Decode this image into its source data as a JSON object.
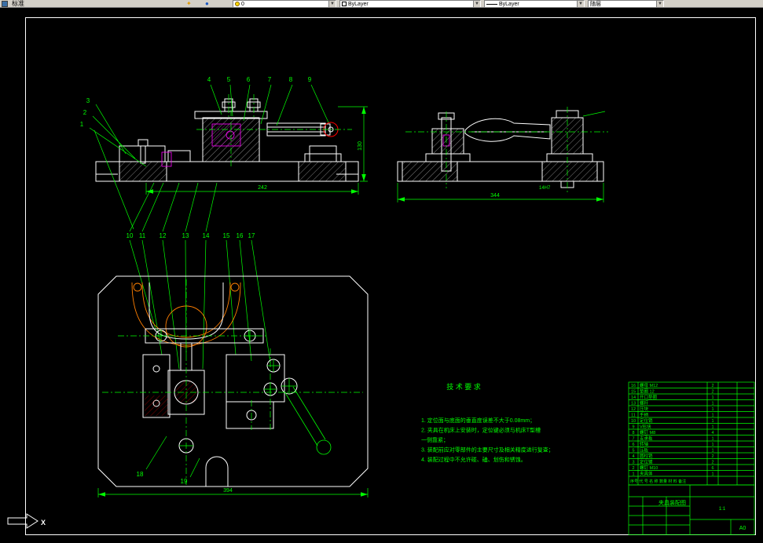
{
  "toolbar": {
    "name": "标准",
    "layer_value": "0",
    "color_value": "ByLayer",
    "linetype_value": "ByLayer",
    "lineweight_value": "随层"
  },
  "colors": {
    "canvas_bg": "#000000",
    "toolbar_bg": "#d4d0c8",
    "geometry": "#ffffff",
    "annotation": "#00ff00",
    "detail_magenta": "#ff00ff",
    "detail_red": "#ff0000",
    "workpiece_orange": "#ff7f00"
  },
  "drawing": {
    "dimensions": {
      "front_width": "242",
      "front_height": "130",
      "side_width": "344",
      "side_key_slot": "14H7",
      "plan_width": "394"
    },
    "balloons": {
      "top": [
        "4",
        "5",
        "6",
        "7",
        "8",
        "9"
      ],
      "left": [
        "3",
        "2",
        "1"
      ],
      "middle": [
        "10",
        "11",
        "12",
        "13",
        "14",
        "15",
        "16",
        "17"
      ],
      "bottom": [
        "18",
        "19"
      ]
    },
    "tech_requirements": {
      "title": "技 术 要 求",
      "lines": [
        "1. 定位面与底面的垂直度误差不大于0.08mm；",
        "2. 夹具在机床上安装时，定位键必须与机床T型槽",
        "   一侧靠紧；",
        "3. 装配前应对零部件的主要尺寸及相关精度进行复查；",
        "4. 装配过程中不允许碰、磕、划伤和锈蚀。"
      ]
    },
    "bom": {
      "header": "序号  代 号   名  称   数量  材 料  备注",
      "rows": [
        {
          "num": "16",
          "desc": "螺母 M12",
          "qty": "2"
        },
        {
          "num": "15",
          "desc": "垫圈 12",
          "qty": "2"
        },
        {
          "num": "14",
          "desc": "开口垫圈",
          "qty": "1"
        },
        {
          "num": "13",
          "desc": "螺杆",
          "qty": "1"
        },
        {
          "num": "12",
          "desc": "压块",
          "qty": "1"
        },
        {
          "num": "11",
          "desc": "手柄",
          "qty": "1"
        },
        {
          "num": "10",
          "desc": "定位销",
          "qty": "1"
        },
        {
          "num": "9",
          "desc": "V形块",
          "qty": "1"
        },
        {
          "num": "8",
          "desc": "螺钉 M8",
          "qty": "4"
        },
        {
          "num": "7",
          "desc": "支承板",
          "qty": "1"
        },
        {
          "num": "6",
          "desc": "转轴",
          "qty": "1"
        },
        {
          "num": "5",
          "desc": "压板",
          "qty": "1"
        },
        {
          "num": "4",
          "desc": "圆柱销",
          "qty": "2"
        },
        {
          "num": "3",
          "desc": "定位键",
          "qty": "2"
        },
        {
          "num": "2",
          "desc": "螺钉 M10",
          "qty": "6"
        },
        {
          "num": "1",
          "desc": "夹具体",
          "qty": "1"
        }
      ]
    },
    "title_block": {
      "title": "夹具装配图",
      "scale": "1:1",
      "sheet": "A0"
    }
  },
  "ucs": {
    "x_label": "X"
  }
}
